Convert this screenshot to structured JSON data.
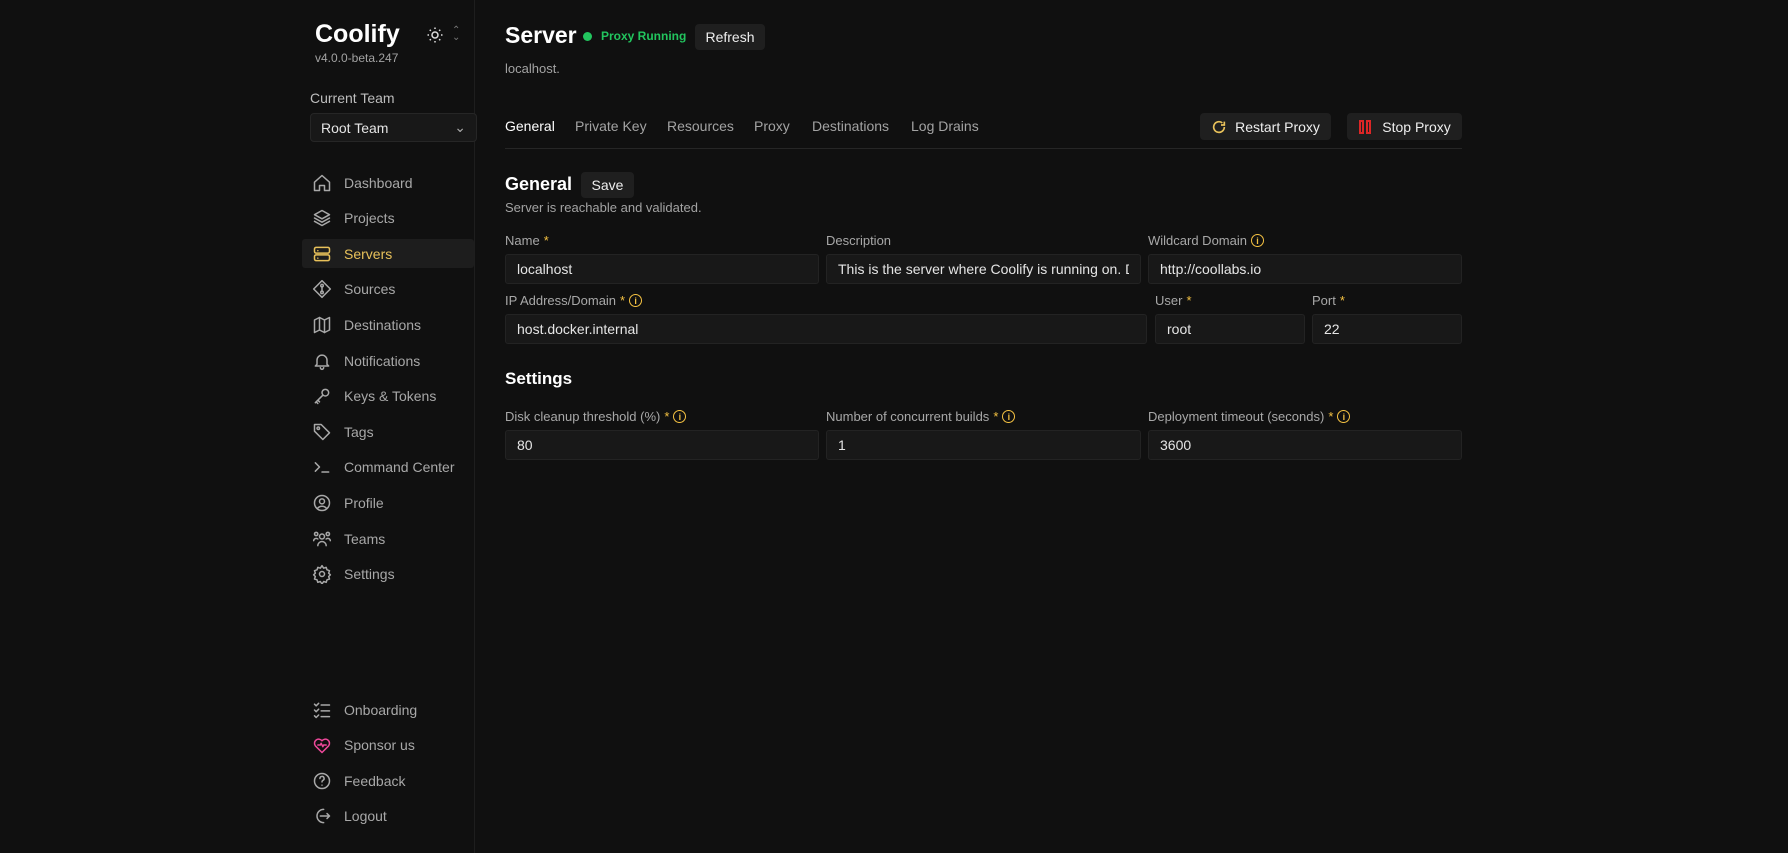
{
  "app": {
    "name": "Coolify",
    "version": "v4.0.0-beta.247"
  },
  "team": {
    "label": "Current Team",
    "value": "Root Team"
  },
  "nav": {
    "items": [
      {
        "label": "Dashboard",
        "icon": "home-icon"
      },
      {
        "label": "Projects",
        "icon": "layers-icon"
      },
      {
        "label": "Servers",
        "icon": "server-icon",
        "active": true
      },
      {
        "label": "Sources",
        "icon": "git-icon"
      },
      {
        "label": "Destinations",
        "icon": "map-icon"
      },
      {
        "label": "Notifications",
        "icon": "bell-icon"
      },
      {
        "label": "Keys & Tokens",
        "icon": "key-icon"
      },
      {
        "label": "Tags",
        "icon": "tag-icon"
      },
      {
        "label": "Command Center",
        "icon": "terminal-icon"
      },
      {
        "label": "Profile",
        "icon": "user-icon"
      },
      {
        "label": "Teams",
        "icon": "users-icon"
      },
      {
        "label": "Settings",
        "icon": "gear-icon"
      }
    ],
    "bottom": [
      {
        "label": "Onboarding",
        "icon": "checklist-icon"
      },
      {
        "label": "Sponsor us",
        "icon": "heart-icon"
      },
      {
        "label": "Feedback",
        "icon": "help-icon"
      },
      {
        "label": "Logout",
        "icon": "logout-icon"
      }
    ]
  },
  "header": {
    "title": "Server",
    "status": "Proxy Running",
    "refresh": "Refresh",
    "subtitle": "localhost."
  },
  "tabs": [
    "General",
    "Private Key",
    "Resources",
    "Proxy",
    "Destinations",
    "Log Drains"
  ],
  "actions": {
    "restart": "Restart Proxy",
    "stop": "Stop Proxy"
  },
  "general": {
    "title": "General",
    "save": "Save",
    "status": "Server is reachable and validated.",
    "name": {
      "label": "Name",
      "value": "localhost"
    },
    "description": {
      "label": "Description",
      "value": "This is the server where Coolify is running on. Don't delete this!"
    },
    "wildcard": {
      "label": "Wildcard Domain",
      "value": "http://coollabs.io"
    },
    "ip": {
      "label": "IP Address/Domain",
      "value": "host.docker.internal"
    },
    "user": {
      "label": "User",
      "value": "root"
    },
    "port": {
      "label": "Port",
      "value": "22"
    }
  },
  "settings": {
    "title": "Settings",
    "disk": {
      "label": "Disk cleanup threshold (%)",
      "value": "80"
    },
    "builds": {
      "label": "Number of concurrent builds",
      "value": "1"
    },
    "timeout": {
      "label": "Deployment timeout (seconds)",
      "value": "3600"
    }
  },
  "colors": {
    "accent": "#e8c15a",
    "success": "#22c55e",
    "danger": "#dc2626"
  }
}
